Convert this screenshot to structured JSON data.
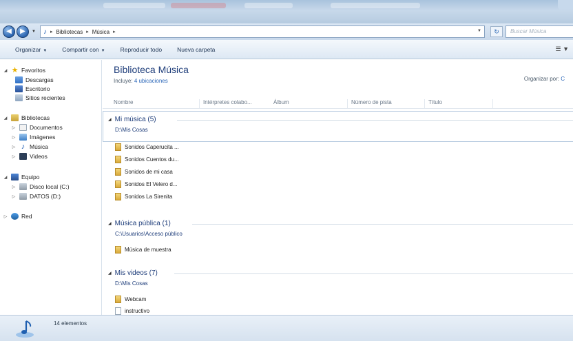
{
  "window": {
    "breadcrumb": [
      "Bibliotecas",
      "Música"
    ],
    "search_placeholder": "Buscar Música"
  },
  "toolbar": {
    "organize": "Organizar",
    "share": "Compartir con",
    "play_all": "Reproducir todo",
    "new_folder": "Nueva carpeta"
  },
  "sidebar": {
    "favorites": {
      "label": "Favoritos",
      "items": [
        "Descargas",
        "Escritorio",
        "Sitios recientes"
      ]
    },
    "libraries": {
      "label": "Bibliotecas",
      "items": [
        "Documentos",
        "Imágenes",
        "Música",
        "Videos"
      ]
    },
    "computer": {
      "label": "Equipo",
      "items": [
        "Disco local (C:)",
        "DATOS (D:)"
      ]
    },
    "network": {
      "label": "Red"
    }
  },
  "library": {
    "title": "Biblioteca Música",
    "includes_label": "Incluye:",
    "includes_link": "4 ubicaciones",
    "arrange_by": "Organizar por:",
    "columns": [
      "Nombre",
      "Intérpretes colabo...",
      "Álbum",
      "Número de pista",
      "Título"
    ]
  },
  "groups": [
    {
      "title": "Mi música (5)",
      "path": "D:\\Mis Cosas",
      "items": [
        "Sonidos Caperucita ...",
        "Sonidos Cuentos du...",
        "Sonidos de mi casa",
        "Sonidos El Velero d...",
        "Sonidos La Sirenita"
      ]
    },
    {
      "title": "Música pública (1)",
      "path": "C:\\Usuarios\\Acceso público",
      "items": [
        "Música de muestra"
      ]
    },
    {
      "title": "Mis videos (7)",
      "path": "D:\\Mis Cosas",
      "items": [
        "Webcam",
        "instructivo"
      ]
    }
  ],
  "status": {
    "count": "14 elementos"
  }
}
